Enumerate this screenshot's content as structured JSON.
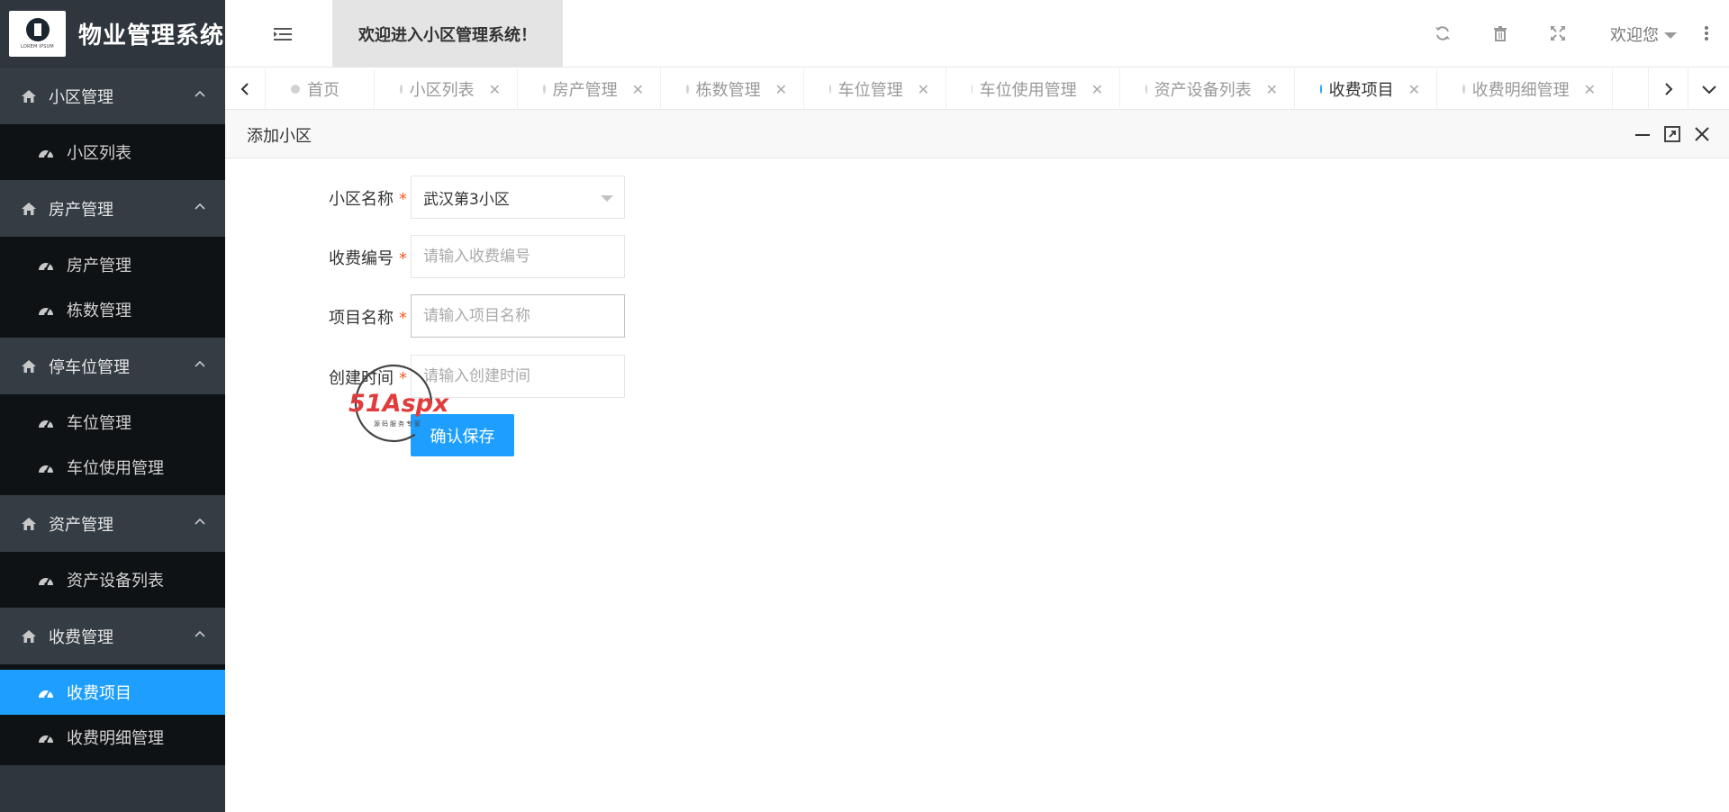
{
  "app": {
    "title": "物业管理系统",
    "logo_caption": "LOREM IPSUM"
  },
  "header": {
    "welcome": "欢迎进入小区管理系统！",
    "user_label": "欢迎您"
  },
  "sidebar": {
    "groups": [
      {
        "label": "小区管理",
        "items": [
          {
            "label": "小区列表"
          }
        ]
      },
      {
        "label": "房产管理",
        "items": [
          {
            "label": "房产管理"
          },
          {
            "label": "栋数管理"
          }
        ]
      },
      {
        "label": "停车位管理",
        "items": [
          {
            "label": "车位管理"
          },
          {
            "label": "车位使用管理"
          }
        ]
      },
      {
        "label": "资产管理",
        "items": [
          {
            "label": "资产设备列表"
          }
        ]
      },
      {
        "label": "收费管理",
        "items": [
          {
            "label": "收费项目",
            "active": true
          },
          {
            "label": "收费明细管理"
          }
        ]
      }
    ]
  },
  "tabs": [
    {
      "label": "首页"
    },
    {
      "label": "小区列表"
    },
    {
      "label": "房产管理"
    },
    {
      "label": "栋数管理"
    },
    {
      "label": "车位管理"
    },
    {
      "label": "车位使用管理"
    },
    {
      "label": "资产设备列表"
    },
    {
      "label": "收费项目",
      "active": true
    },
    {
      "label": "收费明细管理"
    }
  ],
  "panel": {
    "title": "添加小区"
  },
  "form": {
    "community": {
      "label": "小区名称",
      "value": "武汉第3小区"
    },
    "fee_code": {
      "label": "收费编号",
      "placeholder": "请输入收费编号"
    },
    "item_name": {
      "label": "项目名称",
      "placeholder": "请输入项目名称"
    },
    "created_time": {
      "label": "创建时间",
      "placeholder": "请输入创建时间"
    },
    "required_mark": "*",
    "submit_label": "确认保存"
  },
  "watermark": {
    "brand": "51Aspx",
    "tagline": "源码服务专家"
  },
  "colors": {
    "sidebar_bg": "#2f363d",
    "submenu_bg": "#0f1215",
    "accent": "#1E9FFF",
    "required": "#ff5722"
  }
}
